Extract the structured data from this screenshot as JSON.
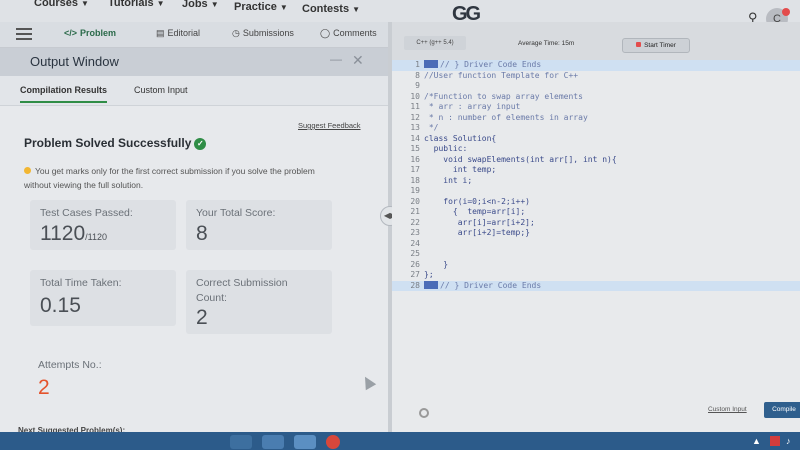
{
  "topnav": {
    "items": [
      "Courses",
      "Tutorials",
      "Jobs",
      "Practice",
      "Contests"
    ],
    "logo": "GG"
  },
  "tabs": {
    "problem": "Problem",
    "editorial": "Editorial",
    "submissions": "Submissions",
    "comments": "Comments"
  },
  "output": {
    "title": "Output Window",
    "subtabs": [
      "Compilation Results",
      "Custom Input"
    ],
    "feedback": "Suggest Feedback",
    "status": "Problem Solved Successfully",
    "note": "You get marks only for the first correct submission if you solve the problem without viewing the full solution.",
    "stats": {
      "tests_label": "Test Cases Passed:",
      "tests_value": "1120",
      "tests_total": "/1120",
      "score_label": "Your Total Score:",
      "score_value": "8",
      "time_label": "Total Time Taken:",
      "time_value": "0.15",
      "correct_label": "Correct Submission Count:",
      "correct_value": "2",
      "attempts_label": "Attempts No.:",
      "attempts_value": "2"
    },
    "next": "Next Suggested Problem(s):"
  },
  "editor": {
    "language": "C++ (g++ 5.4)",
    "avg_time": "Average Time: 15m",
    "timer_label": "Start Timer",
    "custom_input": "Custom Input",
    "compile": "Compile",
    "lines": [
      {
        "n": "1",
        "t": "// } Driver Code Ends",
        "hl": true
      },
      {
        "n": "8",
        "t": "//User function Template for C++"
      },
      {
        "n": "9",
        "t": ""
      },
      {
        "n": "10",
        "t": "/*Function to swap array elements"
      },
      {
        "n": "11",
        "t": " * arr : array input"
      },
      {
        "n": "12",
        "t": " * n : number of elements in array"
      },
      {
        "n": "13",
        "t": " */"
      },
      {
        "n": "14",
        "t": "class Solution{"
      },
      {
        "n": "15",
        "t": "  public:"
      },
      {
        "n": "16",
        "t": "    void swapElements(int arr[], int n){"
      },
      {
        "n": "17",
        "t": "      int temp;"
      },
      {
        "n": "18",
        "t": "    int i;"
      },
      {
        "n": "19",
        "t": ""
      },
      {
        "n": "20",
        "t": "    for(i=0;i<n-2;i++)"
      },
      {
        "n": "21",
        "t": "      {  temp=arr[i];"
      },
      {
        "n": "22",
        "t": "       arr[i]=arr[i+2];"
      },
      {
        "n": "23",
        "t": "       arr[i+2]=temp;}"
      },
      {
        "n": "24",
        "t": ""
      },
      {
        "n": "25",
        "t": ""
      },
      {
        "n": "26",
        "t": "    }"
      },
      {
        "n": "27",
        "t": "};"
      },
      {
        "n": "28",
        "t": "// } Driver Code Ends",
        "hl": true
      }
    ]
  }
}
